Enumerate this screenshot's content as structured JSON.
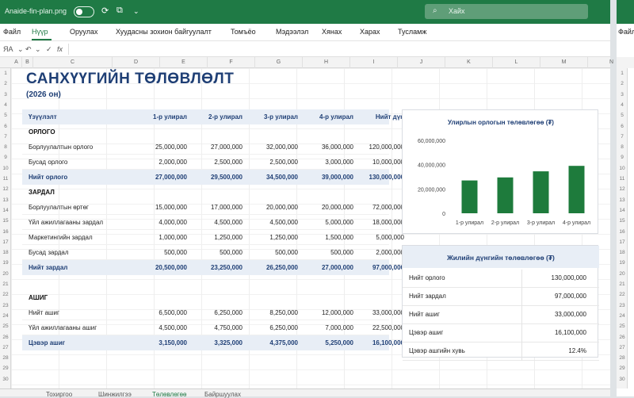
{
  "window": {
    "filename": "Anaide-fin-plan.png",
    "search_placeholder": "Хайх"
  },
  "menu": [
    "Файл",
    "Нүүр",
    "Оруулах",
    "Хуудасны зохион байгуулалт",
    "Томъёо",
    "Мэдээлэл",
    "Хянах",
    "Харах",
    "Тусламж"
  ],
  "formula_bar": {
    "cell_ref": "",
    "fx": "fx"
  },
  "columns": [
    "A",
    "B",
    "C",
    "D",
    "E",
    "F",
    "G",
    "H",
    "I",
    "J",
    "K",
    "L",
    "M",
    "N"
  ],
  "rows": [
    "1",
    "2",
    "3",
    "4",
    "5",
    "6",
    "7",
    "8",
    "9",
    "10",
    "11",
    "12",
    "13",
    "14",
    "15",
    "16",
    "17",
    "18",
    "19",
    "20",
    "21",
    "22",
    "23",
    "24",
    "25",
    "26",
    "27",
    "28",
    "29",
    "30"
  ],
  "sheet": {
    "title": "САНХҮҮГИЙН ТӨЛӨВЛӨЛТ",
    "subtitle": "(2026 он)"
  },
  "table": {
    "headers": [
      "Үзүүлэлт",
      "1-р улирал",
      "2-р улирал",
      "3-р улирал",
      "4-р улирал",
      "Нийт дүн"
    ],
    "rows": [
      {
        "kind": "section",
        "cells": [
          "ОРЛОГО",
          "",
          "",
          "",
          "",
          ""
        ]
      },
      {
        "kind": "data",
        "cells": [
          "Борлуулалтын орлого",
          "25,000,000",
          "27,000,000",
          "32,000,000",
          "36,000,000",
          "120,000,000"
        ]
      },
      {
        "kind": "data",
        "cells": [
          "Бусад орлого",
          "2,000,000",
          "2,500,000",
          "2,500,000",
          "3,000,000",
          "10,000,000"
        ]
      },
      {
        "kind": "total",
        "cells": [
          "Нийт орлого",
          "27,000,000",
          "29,500,000",
          "34,500,000",
          "39,000,000",
          "130,000,000"
        ]
      },
      {
        "kind": "section",
        "cells": [
          "ЗАРДАЛ",
          "",
          "",
          "",
          "",
          ""
        ]
      },
      {
        "kind": "data",
        "cells": [
          "Борлуулалтын өртөг",
          "15,000,000",
          "17,000,000",
          "20,000,000",
          "20,000,000",
          "72,000,000"
        ]
      },
      {
        "kind": "data",
        "cells": [
          "Үйл ажиллагааны зардал",
          "4,000,000",
          "4,500,000",
          "4,500,000",
          "5,000,000",
          "18,000,000"
        ]
      },
      {
        "kind": "data",
        "cells": [
          "Маркетингийн зардал",
          "1,000,000",
          "1,250,000",
          "1,250,000",
          "1,500,000",
          "5,000,000"
        ]
      },
      {
        "kind": "data",
        "cells": [
          "Бусад зардал",
          "500,000",
          "500,000",
          "500,000",
          "500,000",
          "2,000,000"
        ]
      },
      {
        "kind": "total",
        "cells": [
          "Нийт зардал",
          "20,500,000",
          "23,250,000",
          "26,250,000",
          "27,000,000",
          "97,000,000"
        ]
      },
      {
        "kind": "blank",
        "cells": [
          "",
          "",
          "",
          "",
          "",
          ""
        ]
      },
      {
        "kind": "section",
        "cells": [
          "АШИГ",
          "",
          "",
          "",
          "",
          ""
        ]
      },
      {
        "kind": "data",
        "cells": [
          "Нийт ашиг",
          "6,500,000",
          "6,250,000",
          "8,250,000",
          "12,000,000",
          "33,000,000"
        ]
      },
      {
        "kind": "data",
        "cells": [
          "Үйл ажиллагааны ашиг",
          "4,500,000",
          "4,750,000",
          "6,250,000",
          "7,000,000",
          "22,500,000"
        ]
      },
      {
        "kind": "total",
        "cells": [
          "Цэвэр ашиг",
          "3,150,000",
          "3,325,000",
          "4,375,000",
          "5,250,000",
          "16,100,000"
        ]
      }
    ]
  },
  "chart_data": {
    "type": "bar",
    "title": "Улирлын орлогын төлөвлөгөө (₮)",
    "categories": [
      "1-р улирал",
      "2-р улирал",
      "3-р улирал",
      "4-р улирал"
    ],
    "values": [
      27000000,
      29500000,
      34500000,
      39000000
    ],
    "ylim": [
      0,
      60000000
    ],
    "yticks": [
      0,
      20000000,
      40000000,
      60000000
    ],
    "ytick_labels": [
      "0",
      "20,000,000",
      "40,000,000",
      "60,000,000"
    ],
    "grid": false,
    "bar_color": "#1e7b3c"
  },
  "summary": {
    "title": "Жилийн дүнгийн төлөвлөгөө (₮)",
    "rows": [
      {
        "label": "Нийт орлого",
        "value": "130,000,000"
      },
      {
        "label": "Нийт зардал",
        "value": "97,000,000"
      },
      {
        "label": "Нийт ашиг",
        "value": "33,000,000"
      },
      {
        "label": "Цэвэр ашиг",
        "value": "16,100,000"
      },
      {
        "label": "Цэвэр ашгийн хувь",
        "value": "12.4%"
      }
    ]
  },
  "sheet_tabs": [
    "Тохиргоо",
    "Шинжилгээ",
    "Төлөвлөгөө",
    "Байршуулах"
  ],
  "colors": {
    "brand": "#1f7a45",
    "header_text": "#1f3f75",
    "table_header_bg": "#e8eef6"
  }
}
